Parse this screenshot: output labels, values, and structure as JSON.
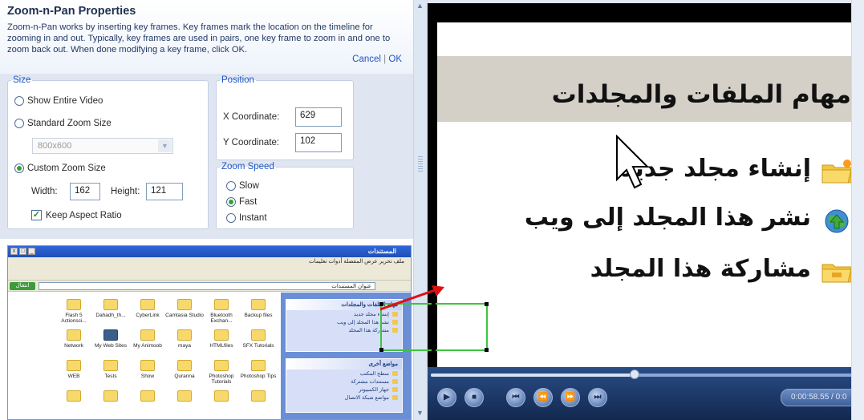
{
  "header": {
    "title": "Zoom-n-Pan Properties",
    "description": "Zoom-n-Pan works by inserting key frames. Key frames mark the location on the timeline for zooming in and out. Typically, key frames are used in pairs, one key frame to zoom in and one to zoom back out. When done modifying a key frame, click OK.",
    "cancel_label": "Cancel",
    "separator": "|",
    "ok_label": "OK"
  },
  "size": {
    "legend": "Size",
    "show_entire_label": "Show Entire Video",
    "standard_label": "Standard Zoom Size",
    "standard_value": "800x600",
    "custom_label": "Custom Zoom Size",
    "selected": "custom",
    "width_label": "Width:",
    "width_value": "162",
    "height_label": "Height:",
    "height_value": "121",
    "keep_aspect_label": "Keep Aspect Ratio",
    "keep_aspect_checked": true
  },
  "position": {
    "legend": "Position",
    "x_label": "X Coordinate:",
    "x_value": "629",
    "y_label": "Y Coordinate:",
    "y_value": "102"
  },
  "zoom_speed": {
    "legend": "Zoom Speed",
    "slow_label": "Slow",
    "fast_label": "Fast",
    "instant_label": "Instant",
    "selected": "fast"
  },
  "thumbnail": {
    "window_title": "المستندات",
    "menu": "ملف تحرير عرض المفضلة أدوات تعليمات",
    "address": "عنوان المستندات",
    "go_label": "انتقال",
    "files": [
      {
        "label": "Flash 5 Actionsci...",
        "dark": false
      },
      {
        "label": "Dahadh_th...",
        "dark": false
      },
      {
        "label": "CyberLink",
        "dark": false
      },
      {
        "label": "Camtasia Studio",
        "dark": false
      },
      {
        "label": "Bluetooth Exchan...",
        "dark": false
      },
      {
        "label": "Backup files",
        "dark": false
      },
      {
        "label": "Network",
        "dark": false
      },
      {
        "label": "My Web Sites",
        "dark": true
      },
      {
        "label": "My Animoob",
        "dark": false
      },
      {
        "label": "maya",
        "dark": false
      },
      {
        "label": "HTMLfiles",
        "dark": false
      },
      {
        "label": "SFX Tutorials",
        "dark": false
      },
      {
        "label": "WEB",
        "dark": false
      },
      {
        "label": "Tests",
        "dark": false
      },
      {
        "label": "Show",
        "dark": false
      },
      {
        "label": "Quranna",
        "dark": false
      },
      {
        "label": "Photoshop Tutorials",
        "dark": false
      },
      {
        "label": "Photoshop Tips",
        "dark": false
      },
      {
        "label": "",
        "dark": false
      },
      {
        "label": "",
        "dark": false
      },
      {
        "label": "",
        "dark": false
      },
      {
        "label": "",
        "dark": false
      },
      {
        "label": "",
        "dark": false
      },
      {
        "label": "",
        "dark": false
      }
    ],
    "tasks_header": "مهام الملفات والمجلدات",
    "tasks": [
      "إنشاء مجلد جديد",
      "نشر هذا المجلد إلى ويب",
      "مشاركة هذا المجلد"
    ],
    "places_header": "مواضع أخرى",
    "places": [
      "سطح المكتب",
      "مستندات مشتركة",
      "جهاز الكمبيوتر",
      "مواضع شبكة الاتصال"
    ]
  },
  "preview": {
    "title": "مهام الملفات والمجلدات",
    "items": [
      "إنشاء مجلد جديد",
      "نشر هذا المجلد إلى ويب",
      "مشاركة هذا المجلد"
    ]
  },
  "player": {
    "time": "0:00:58.55 / 0:0",
    "seek_fraction": 0.48,
    "buttons": [
      "play",
      "stop",
      "prev",
      "rewind",
      "forward",
      "next"
    ]
  },
  "colors": {
    "accent": "#1f56c4",
    "selection_green": "#3ec43e",
    "arrow_red": "#e01010"
  }
}
